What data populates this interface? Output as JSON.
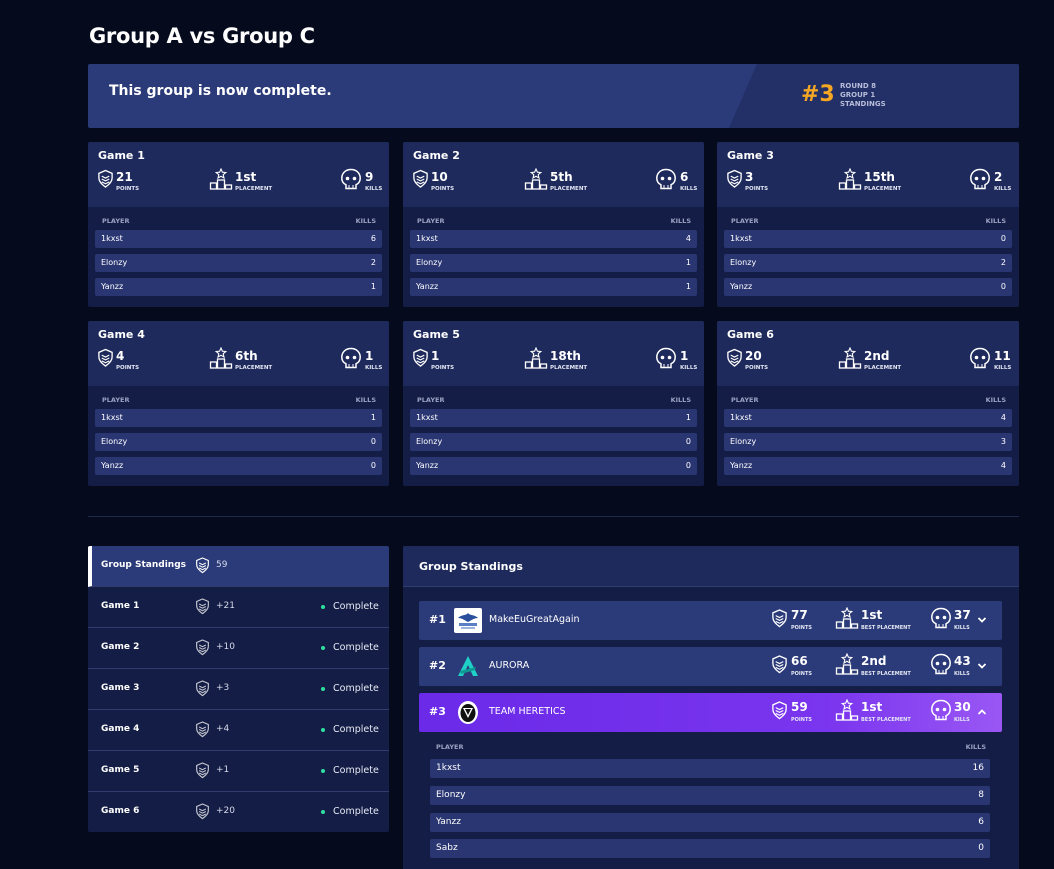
{
  "page": {
    "title": "Group A vs Group C"
  },
  "banner": {
    "message": "This group is now complete.",
    "rank": "#3",
    "meta": [
      "ROUND 8",
      "GROUP 1",
      "STANDINGS"
    ]
  },
  "labels": {
    "points": "POINTS",
    "placement": "PLACEMENT",
    "kills": "KILLS",
    "player": "PLAYER",
    "best_placement": "BEST PLACEMENT"
  },
  "games": [
    {
      "title": "Game 1",
      "points": "21",
      "placement": "1st",
      "kills": "9",
      "players": [
        {
          "name": "1kxst",
          "kills": "6"
        },
        {
          "name": "Elonzy",
          "kills": "2"
        },
        {
          "name": "Yanzz",
          "kills": "1"
        }
      ]
    },
    {
      "title": "Game 2",
      "points": "10",
      "placement": "5th",
      "kills": "6",
      "players": [
        {
          "name": "1kxst",
          "kills": "4"
        },
        {
          "name": "Elonzy",
          "kills": "1"
        },
        {
          "name": "Yanzz",
          "kills": "1"
        }
      ]
    },
    {
      "title": "Game 3",
      "points": "3",
      "placement": "15th",
      "kills": "2",
      "players": [
        {
          "name": "1kxst",
          "kills": "0"
        },
        {
          "name": "Elonzy",
          "kills": "2"
        },
        {
          "name": "Yanzz",
          "kills": "0"
        }
      ]
    },
    {
      "title": "Game 4",
      "points": "4",
      "placement": "6th",
      "kills": "1",
      "players": [
        {
          "name": "1kxst",
          "kills": "1"
        },
        {
          "name": "Elonzy",
          "kills": "0"
        },
        {
          "name": "Yanzz",
          "kills": "0"
        }
      ]
    },
    {
      "title": "Game 5",
      "points": "1",
      "placement": "18th",
      "kills": "1",
      "players": [
        {
          "name": "1kxst",
          "kills": "1"
        },
        {
          "name": "Elonzy",
          "kills": "0"
        },
        {
          "name": "Yanzz",
          "kills": "0"
        }
      ]
    },
    {
      "title": "Game 6",
      "points": "20",
      "placement": "2nd",
      "kills": "11",
      "players": [
        {
          "name": "1kxst",
          "kills": "4"
        },
        {
          "name": "Elonzy",
          "kills": "3"
        },
        {
          "name": "Yanzz",
          "kills": "4"
        }
      ]
    }
  ],
  "left_panel": {
    "rows": [
      {
        "label": "Group Standings",
        "value": "59",
        "status": ""
      },
      {
        "label": "Game 1",
        "value": "+21",
        "status": "Complete"
      },
      {
        "label": "Game 2",
        "value": "+10",
        "status": "Complete"
      },
      {
        "label": "Game 3",
        "value": "+3",
        "status": "Complete"
      },
      {
        "label": "Game 4",
        "value": "+4",
        "status": "Complete"
      },
      {
        "label": "Game 5",
        "value": "+1",
        "status": "Complete"
      },
      {
        "label": "Game 6",
        "value": "+20",
        "status": "Complete"
      }
    ]
  },
  "standings": {
    "title": "Group Standings",
    "teams": [
      {
        "rank": "#1",
        "name": "MakeEuGreatAgain",
        "points": "77",
        "best_placement": "1st",
        "kills": "37"
      },
      {
        "rank": "#2",
        "name": "AURORA",
        "points": "66",
        "best_placement": "2nd",
        "kills": "43"
      },
      {
        "rank": "#3",
        "name": "TEAM HERETICS",
        "points": "59",
        "best_placement": "1st",
        "kills": "30"
      }
    ],
    "expanded_players": [
      {
        "name": "1kxst",
        "kills": "16"
      },
      {
        "name": "Elonzy",
        "kills": "8"
      },
      {
        "name": "Yanzz",
        "kills": "6"
      },
      {
        "name": "Sabz",
        "kills": "0"
      }
    ]
  },
  "colors": {
    "background": "#050b1c",
    "card": "#141d45",
    "card_header": "#1e2a5c",
    "row": "#2a3672",
    "accent_rank": "#f5a623",
    "complete_dot": "#2ee0a0",
    "highlight_team": "#7a35ee"
  }
}
